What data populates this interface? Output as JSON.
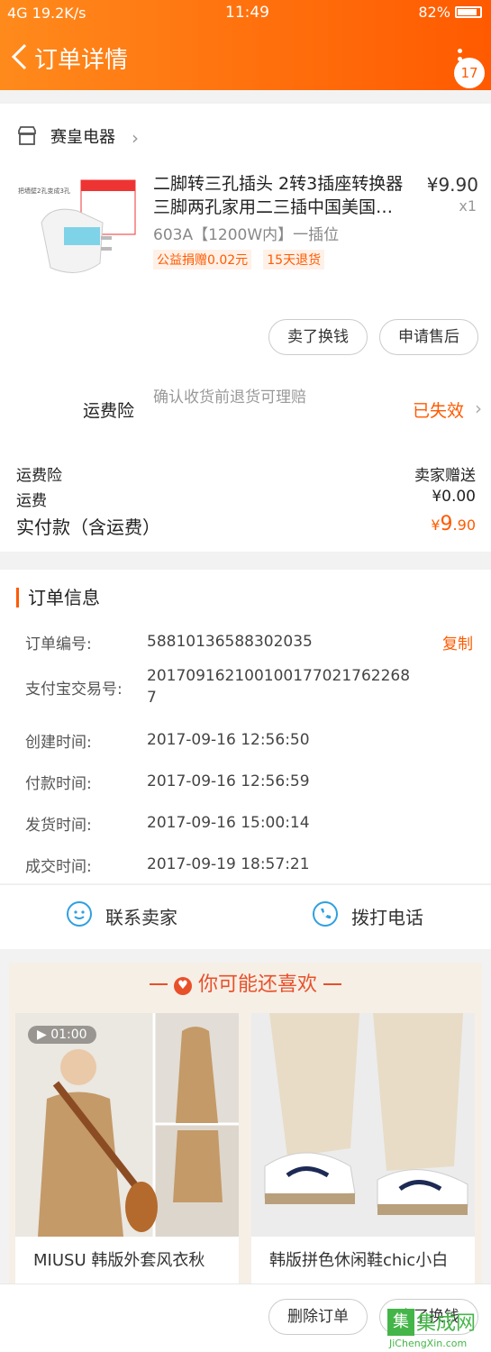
{
  "status_bar": {
    "left": "4G 19.2K/s",
    "time": "11:49",
    "battery": "82%"
  },
  "nav": {
    "title": "订单详情",
    "badge": "17"
  },
  "order": {
    "shop_name": "赛皇电器",
    "product": {
      "title_line1": "二脚转三孔插头 2转3插座转换器",
      "title_line2": "三脚两孔家用二三插中国美国…",
      "price": "¥9.90",
      "qty": "x1",
      "spec": "603A【1200W内】一插位",
      "tags": [
        "公益捐赠0.02元",
        "15天退货"
      ]
    },
    "buttons": {
      "sell": "卖了换钱",
      "after_sale": "申请售后"
    },
    "insurance": {
      "label": "运费险",
      "desc": "确认收货前退货可理赔",
      "status": "已失效"
    },
    "summary": [
      {
        "label": "运费险",
        "value": "卖家赠送"
      },
      {
        "label": "运费",
        "value": "¥0.00"
      }
    ],
    "total": {
      "label": "实付款（含运费）",
      "currency": "¥",
      "int": "9",
      "dec": ".90"
    }
  },
  "order_info": {
    "title": "订单信息",
    "copy": "复制",
    "rows": [
      {
        "label": "订单编号:",
        "value": "58810136588302035"
      },
      {
        "label": "支付宝交易号:",
        "value": "201709162100100177021762268 7"
      },
      {
        "label": "创建时间:",
        "value": "2017-09-16 12:56:50"
      },
      {
        "label": "付款时间:",
        "value": "2017-09-16 12:56:59"
      },
      {
        "label": "发货时间:",
        "value": "2017-09-16 15:00:14"
      },
      {
        "label": "成交时间:",
        "value": "2017-09-19 18:57:21"
      }
    ]
  },
  "contact": {
    "seller": "联系卖家",
    "call": "拨打电话"
  },
  "recommend": {
    "title": "你可能还喜欢",
    "items": [
      {
        "name": "MIUSU 韩版外套风衣秋",
        "video": "01:00"
      },
      {
        "name": "韩版拼色休闲鞋chic小白"
      }
    ]
  },
  "bottom": {
    "delete": "删除订单",
    "sell": "卖了换钱"
  },
  "watermark": {
    "text": "集成网",
    "url": "JiChengXin.com"
  }
}
